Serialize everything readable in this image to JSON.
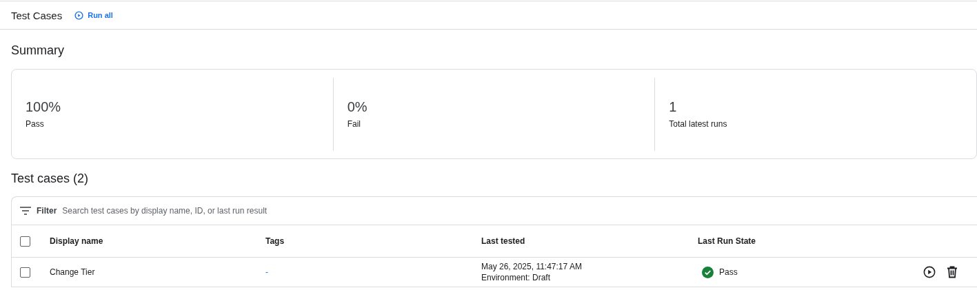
{
  "header": {
    "title": "Test Cases",
    "run_all": "Run all"
  },
  "summary": {
    "title": "Summary",
    "stats": [
      {
        "value": "100%",
        "label": "Pass"
      },
      {
        "value": "0%",
        "label": "Fail"
      },
      {
        "value": "1",
        "label": "Total latest runs"
      }
    ]
  },
  "test_cases": {
    "title": "Test cases (2)",
    "filter": {
      "label": "Filter",
      "placeholder": "Search test cases by display name, ID, or last run result"
    },
    "columns": [
      "Display name",
      "Tags",
      "Last tested",
      "Last Run State"
    ],
    "header_checked": false,
    "rows": [
      {
        "checked": false,
        "name": "Change Tier",
        "tags": "-",
        "last_tested": "May 26, 2025, 11:47:17 AM",
        "environment": "Environment: Draft",
        "state": "Pass",
        "passed": true
      }
    ]
  }
}
